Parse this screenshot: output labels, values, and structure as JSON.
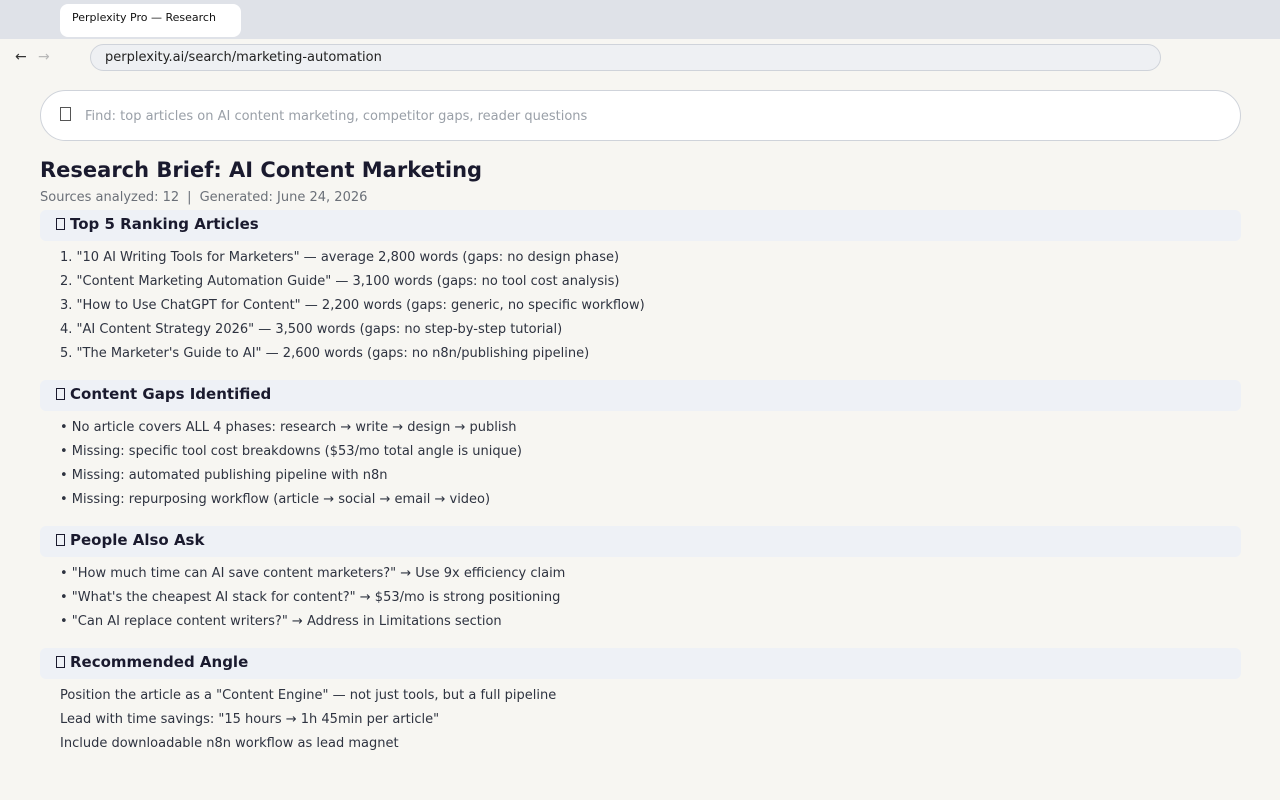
{
  "browser": {
    "tab_title": "Perplexity Pro — Research",
    "back_glyph": "←",
    "forward_glyph": "→",
    "url": "perplexity.ai/search/marketing-automation"
  },
  "search": {
    "placeholder": "Find: top articles on AI content marketing, competitor gaps, reader questions",
    "value": "",
    "icon": "search-icon"
  },
  "brief": {
    "title": "Research Brief: AI Content Marketing",
    "sources": "Sources analyzed: 12",
    "separator": "|",
    "generated": "Generated: June 24, 2026"
  },
  "sections": {
    "top_articles": {
      "heading": "Top 5 Ranking Articles",
      "items": [
        "1. \"10 AI Writing Tools for Marketers\" — average 2,800 words (gaps: no design phase)",
        "2. \"Content Marketing Automation Guide\" — 3,100 words (gaps: no tool cost analysis)",
        "3. \"How to Use ChatGPT for Content\" — 2,200 words (gaps: generic, no specific workflow)",
        "4. \"AI Content Strategy 2026\" — 3,500 words (gaps: no step-by-step tutorial)",
        "5. \"The Marketer's Guide to AI\" — 2,600 words (gaps: no n8n/publishing pipeline)"
      ]
    },
    "content_gaps": {
      "heading": "Content Gaps Identified",
      "items": [
        "• No article covers ALL 4 phases: research → write → design → publish",
        "• Missing: specific tool cost breakdowns ($53/mo total angle is unique)",
        "• Missing: automated publishing pipeline with n8n",
        "• Missing: repurposing workflow (article → social → email → video)"
      ]
    },
    "people_also_ask": {
      "heading": "People Also Ask",
      "items": [
        "• \"How much time can AI save content marketers?\" → Use 9x efficiency claim",
        "• \"What's the cheapest AI stack for content?\" → $53/mo is strong positioning",
        "• \"Can AI replace content writers?\" → Address in Limitations section"
      ]
    },
    "recommended_angle": {
      "heading": "Recommended Angle",
      "items": [
        "Position the article as a \"Content Engine\" — not just tools, but a full pipeline",
        "Lead with time savings: \"15 hours → 1h 45min per article\"",
        "Include downloadable n8n workflow as lead magnet"
      ]
    }
  }
}
